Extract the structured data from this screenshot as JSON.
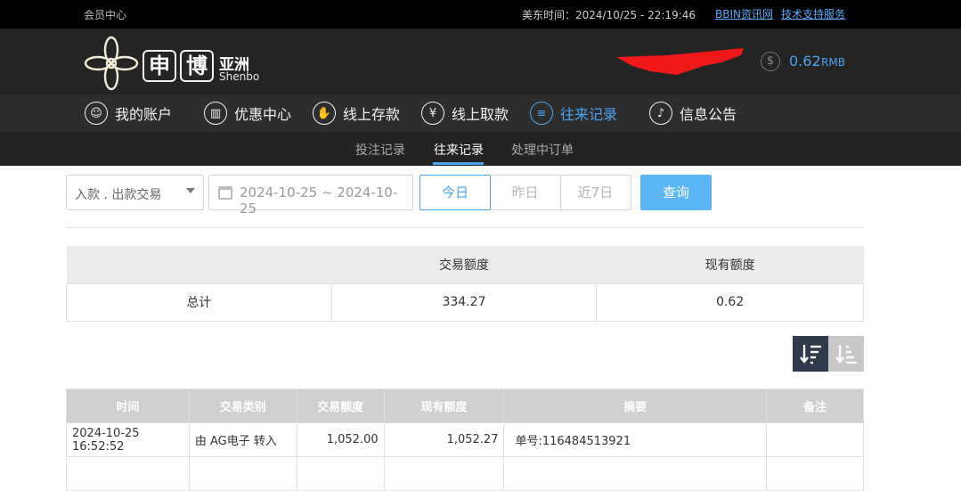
{
  "topbar": {
    "member_center": "会员中心",
    "time_label": "美东时间：2024/10/25 - 22:19:46",
    "link_bbin": "BBIN资讯网",
    "link_support": "技术支持服务"
  },
  "logo": {
    "char1": "申",
    "char2": "博",
    "cn": "亚洲",
    "en": "Shenbo"
  },
  "balance": {
    "icon": "dollar-icon",
    "amount": "0.62",
    "currency": "RMB"
  },
  "nav": {
    "items": [
      {
        "label": "我的账户",
        "icon": "user-icon"
      },
      {
        "label": "优惠中心",
        "icon": "gift-icon"
      },
      {
        "label": "线上存款",
        "icon": "deposit-icon"
      },
      {
        "label": "线上取款",
        "icon": "withdraw-icon"
      },
      {
        "label": "往来记录",
        "icon": "records-icon"
      },
      {
        "label": "信息公告",
        "icon": "bell-icon"
      }
    ]
  },
  "subnav": {
    "items": [
      "投注记录",
      "往来记录",
      "处理中订单"
    ]
  },
  "filter": {
    "type": "入款 . 出款交易",
    "date_range": "2024-10-25 ~ 2024-10-25",
    "quick": [
      "今日",
      "昨日",
      "近7日"
    ],
    "query": "查询"
  },
  "summary": {
    "headers": [
      "",
      "交易额度",
      "现有额度"
    ],
    "row": [
      "总计",
      "334.27",
      "0.62"
    ]
  },
  "detail": {
    "headers": [
      "时间",
      "交易类别",
      "交易额度",
      "现有额度",
      "摘要",
      "备注"
    ],
    "rows": [
      [
        "2024-10-25 16:52:52",
        "由 AG电子 转入",
        "1,052.00",
        "1,052.27",
        "单号:116484513921",
        ""
      ]
    ]
  },
  "colors": {
    "accent": "#4aa3f0",
    "query_btn": "#5cb6f5",
    "sort_active": "#2f3a4a",
    "sort_inactive": "#c8c8c8"
  }
}
